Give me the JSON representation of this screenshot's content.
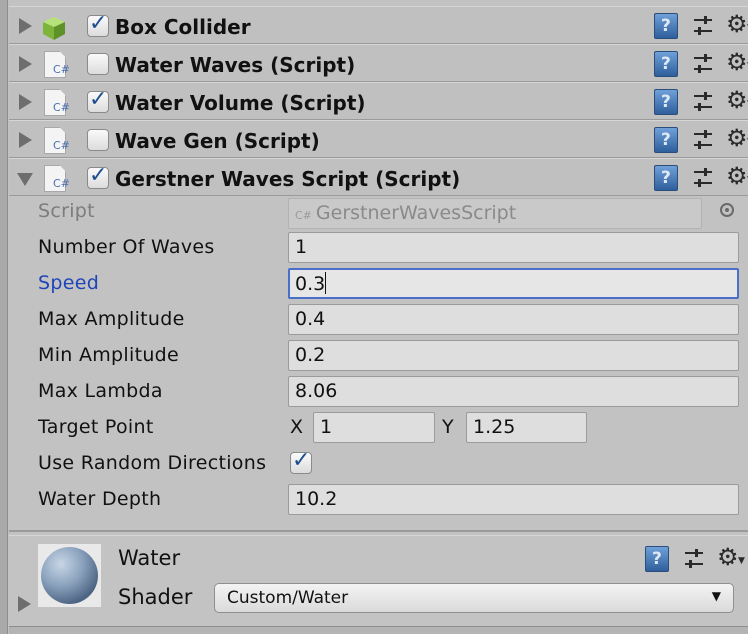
{
  "components": [
    {
      "title": "Box Collider",
      "icon": "cube-icon",
      "checked": true,
      "expanded": false
    },
    {
      "title": "Water Waves (Script)",
      "icon": "csharp-script-icon",
      "checked": false,
      "expanded": false
    },
    {
      "title": "Water Volume (Script)",
      "icon": "csharp-script-icon",
      "checked": true,
      "expanded": false
    },
    {
      "title": "Wave Gen (Script)",
      "icon": "csharp-script-icon",
      "checked": false,
      "expanded": false
    },
    {
      "title": "Gerstner Waves Script (Script)",
      "icon": "csharp-script-icon",
      "checked": true,
      "expanded": true
    }
  ],
  "cs_glyph": "C#",
  "help_glyph": "?",
  "gerstner": {
    "script_label": "Script",
    "script_value": "GerstnerWavesScript",
    "number_of_waves_label": "Number Of Waves",
    "number_of_waves": "1",
    "speed_label": "Speed",
    "speed": "0.3",
    "max_amplitude_label": "Max Amplitude",
    "max_amplitude": "0.4",
    "min_amplitude_label": "Min Amplitude",
    "min_amplitude": "0.2",
    "max_lambda_label": "Max Lambda",
    "max_lambda": "8.06",
    "target_point_label": "Target Point",
    "target_x_label": "X",
    "target_x": "1",
    "target_y_label": "Y",
    "target_y": "1.25",
    "use_random_directions_label": "Use Random Directions",
    "use_random_directions": true,
    "water_depth_label": "Water Depth",
    "water_depth": "10.2"
  },
  "material": {
    "name": "Water",
    "shader_label": "Shader",
    "shader_value": "Custom/Water"
  },
  "colors": {
    "accent": "#1f44b8",
    "focus_border": "#4a6fc8",
    "panel_bg": "#c2c2c2"
  }
}
